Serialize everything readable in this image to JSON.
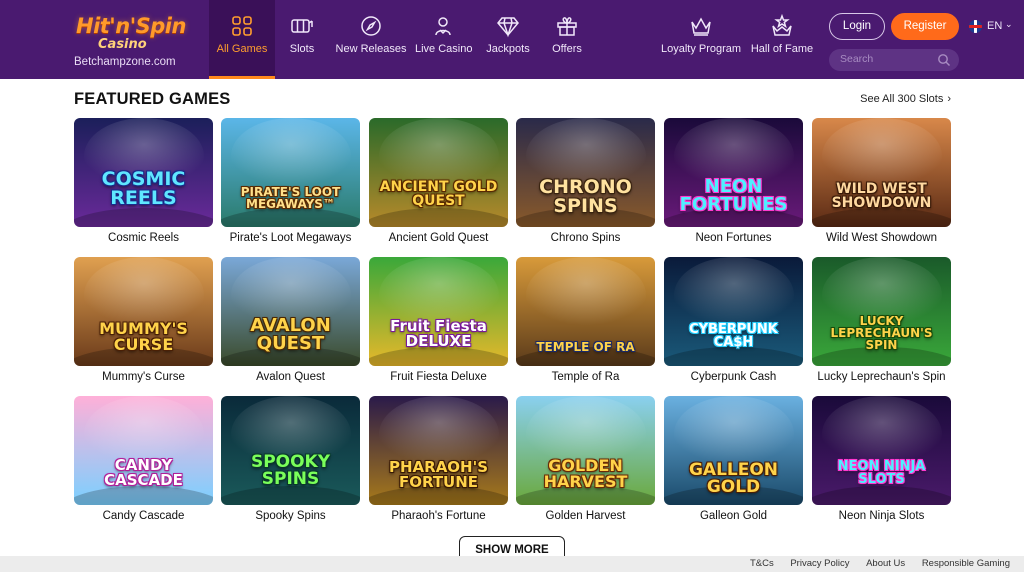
{
  "brand": {
    "logo_main": "Hit'n'Spin",
    "logo_sub": "Casino",
    "domain": "Betchampzone.com"
  },
  "nav": [
    {
      "label": "All Games",
      "icon": "grid-icon",
      "active": true
    },
    {
      "label": "Slots",
      "icon": "slot-machine-icon",
      "active": false
    },
    {
      "label": "New Releases",
      "icon": "compass-icon",
      "active": false
    },
    {
      "label": "Live Casino",
      "icon": "dealer-icon",
      "active": false
    },
    {
      "label": "Jackpots",
      "icon": "diamond-icon",
      "active": false
    },
    {
      "label": "Offers",
      "icon": "gift-icon",
      "active": false
    },
    {
      "label": "Loyalty Program",
      "icon": "crown-icon",
      "active": false
    },
    {
      "label": "Hall of Fame",
      "icon": "star-crown-icon",
      "active": false
    }
  ],
  "auth": {
    "login": "Login",
    "register": "Register"
  },
  "lang": {
    "code": "EN",
    "chevron": "⌄"
  },
  "search": {
    "placeholder": "Search"
  },
  "section": {
    "title": "FEATURED GAMES",
    "see_all": "See All 300 Slots",
    "see_all_arrow": "›"
  },
  "games": [
    {
      "name": "Cosmic Reels",
      "art_title": "COSMIC\nREELS"
    },
    {
      "name": "Pirate's Loot Megaways",
      "art_title": "PIRATE'S LOOT\nMEGAWAYS™"
    },
    {
      "name": "Ancient Gold Quest",
      "art_title": "ANCIENT GOLD\nQUEST"
    },
    {
      "name": "Chrono Spins",
      "art_title": "CHRONO\nSPINS"
    },
    {
      "name": "Neon Fortunes",
      "art_title": "NEON\nFORTUNES"
    },
    {
      "name": "Wild West Showdown",
      "art_title": "WILD WEST\nSHOWDOWN"
    },
    {
      "name": "Mummy's Curse",
      "art_title": "MUMMY'S\nCURSE"
    },
    {
      "name": "Avalon Quest",
      "art_title": "AVALON\nQUEST"
    },
    {
      "name": "Fruit Fiesta Deluxe",
      "art_title": "Fruit Fiesta\nDELUXE"
    },
    {
      "name": "Temple of Ra",
      "art_title": "TEMPLE OF RA"
    },
    {
      "name": "Cyberpunk Cash",
      "art_title": "CYBERPUNK\nCA$H"
    },
    {
      "name": "Lucky Leprechaun's Spin",
      "art_title": "LUCKY\nLEPRECHAUN'S\nSPIN"
    },
    {
      "name": "Candy Cascade",
      "art_title": "CANDY\nCASCADE"
    },
    {
      "name": "Spooky Spins",
      "art_title": "SPOOKY\nSPINS"
    },
    {
      "name": "Pharaoh's Fortune",
      "art_title": "PHARAOH'S\nFORTUNE"
    },
    {
      "name": "Golden Harvest",
      "art_title": "GOLDEN\nHARVEST"
    },
    {
      "name": "Galleon Gold",
      "art_title": "GALLEON\nGOLD"
    },
    {
      "name": "Neon Ninja Slots",
      "art_title": "NEON NINJA\nSLOTS"
    }
  ],
  "show_more": "SHOW MORE",
  "footer": {
    "links": [
      "T&Cs",
      "Privacy Policy",
      "About Us",
      "Responsible Gaming"
    ]
  },
  "colors": {
    "header_bg": "#4a1a70",
    "accent": "#ff8a1c",
    "register_bg": "#ff6a1a"
  }
}
